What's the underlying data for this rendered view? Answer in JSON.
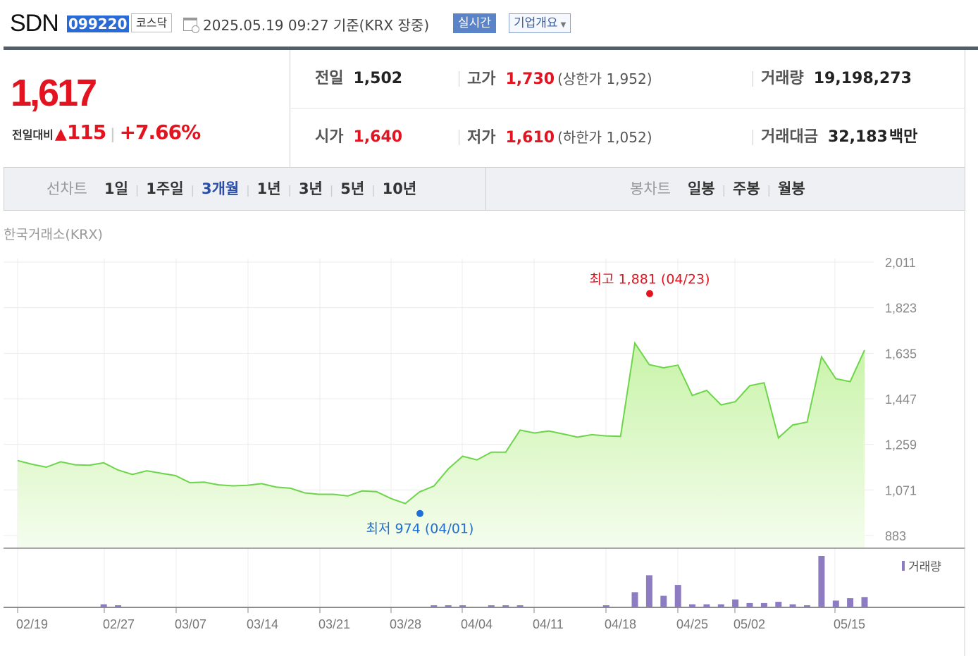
{
  "header": {
    "company_name": "SDN",
    "stock_code": "099220",
    "market": "코스닥",
    "as_of": "2025.05.19 09:27  기준(KRX 장중)",
    "realtime_button": "실시간",
    "company_overview_button": "기업개요"
  },
  "price": {
    "current": "1,617",
    "change_label": "전일대비",
    "change_direction": "up",
    "change_amount": "115",
    "change_percent": "+7.66%"
  },
  "stats": {
    "prev_close": {
      "label": "전일",
      "value": "1,502"
    },
    "open": {
      "label": "시가",
      "value": "1,640"
    },
    "high": {
      "label": "고가",
      "value": "1,730",
      "limit": "(상한가 1,952)"
    },
    "low": {
      "label": "저가",
      "value": "1,610",
      "limit": "(하한가 1,052)"
    },
    "volume": {
      "label": "거래량",
      "value": "19,198,273"
    },
    "trading_value": {
      "label": "거래대금",
      "value": "32,183",
      "unit": "백만"
    }
  },
  "tabs": {
    "line_chart_caption": "선차트",
    "line_periods": [
      "1일",
      "1주일",
      "3개월",
      "1년",
      "3년",
      "5년",
      "10년"
    ],
    "active_period": "3개월",
    "candle_chart_caption": "봉차트",
    "candle_periods": [
      "일봉",
      "주봉",
      "월봉"
    ]
  },
  "exchange": "한국거래소(KRX)",
  "colors": {
    "up_red": "#e3141f",
    "down_blue": "#1f6fd6",
    "line_green": "#6cd54a",
    "volume_purple": "#8e7cc3",
    "active_tab_blue": "#2a4fa8"
  },
  "chart_data": {
    "type": "area",
    "title": "",
    "xlabel": "",
    "ylabel": "",
    "ylim": [
      883,
      2011
    ],
    "yticks": [
      "2,011",
      "1,823",
      "1,635",
      "1,447",
      "1,259",
      "1,071",
      "883"
    ],
    "xtick_labels": [
      "02/19",
      "02/27",
      "03/07",
      "03/14",
      "03/21",
      "03/28",
      "04/04",
      "04/11",
      "04/18",
      "04/25",
      "05/02",
      "05/15"
    ],
    "grid": true,
    "price_series": [
      1192,
      1177,
      1165,
      1187,
      1175,
      1173,
      1183,
      1153,
      1135,
      1150,
      1140,
      1130,
      1101,
      1103,
      1092,
      1088,
      1090,
      1097,
      1083,
      1078,
      1059,
      1053,
      1053,
      1046,
      1067,
      1064,
      1036,
      1015,
      1063,
      1087,
      1158,
      1210,
      1195,
      1227,
      1227,
      1318,
      1306,
      1314,
      1302,
      1289,
      1299,
      1294,
      1292,
      1677,
      1588,
      1575,
      1586,
      1461,
      1482,
      1422,
      1435,
      1501,
      1513,
      1286,
      1339,
      1351,
      1620,
      1530,
      1518,
      1648
    ],
    "max_marker": {
      "label": "최고 1,881 (04/23)",
      "value": 1881
    },
    "min_marker": {
      "label": "최저 974 (04/01)",
      "value": 974
    },
    "volume_label": "거래량",
    "volume_series": [
      0,
      0,
      0,
      0,
      0,
      0,
      2,
      1,
      0,
      0,
      0,
      0,
      0,
      0,
      0,
      0,
      0,
      0,
      0,
      0,
      0,
      0,
      0,
      0,
      0,
      0,
      0,
      0,
      0,
      1,
      1,
      1,
      0,
      1,
      1,
      1,
      0,
      0,
      0,
      0,
      0,
      1,
      0,
      12,
      26,
      9,
      18,
      2,
      2,
      2,
      6,
      3,
      3,
      4,
      2,
      1,
      42,
      5,
      7,
      8
    ]
  }
}
